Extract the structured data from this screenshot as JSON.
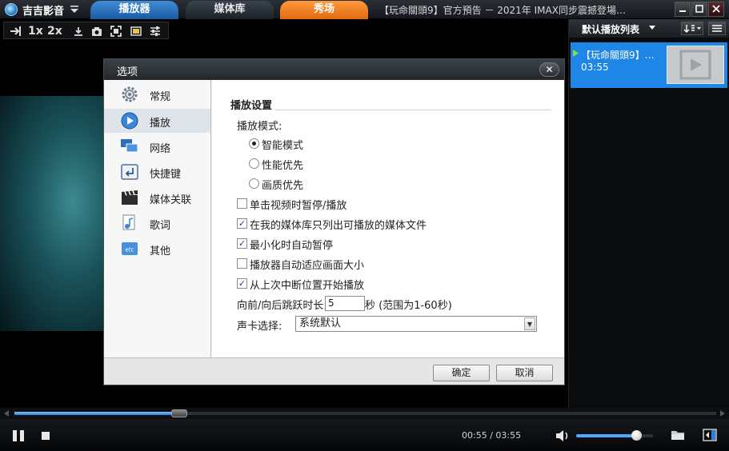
{
  "app": {
    "name": "吉吉影音",
    "tabs": [
      {
        "label": "播放器"
      },
      {
        "label": "媒体库"
      },
      {
        "label": "秀场"
      }
    ],
    "video_title": "【玩命關頭9】官方預告 － 2021年 IMAX同步震撼登場…"
  },
  "toolbar": {
    "speed_1x": "1x",
    "speed_2x": "2x"
  },
  "playlist": {
    "title": "默认播放列表",
    "items": [
      {
        "title": "【玩命關頭9】…",
        "duration": "03:55"
      }
    ]
  },
  "player": {
    "current_time": "00:55",
    "separator": "/",
    "total_time": "03:55",
    "progress_fraction": 0.235,
    "volume_fraction": 0.79
  },
  "dialog": {
    "title": "选项",
    "close_label": "✕",
    "sidebar": [
      {
        "label": "常规",
        "icon": "gear-icon"
      },
      {
        "label": "播放",
        "icon": "play-icon"
      },
      {
        "label": "网络",
        "icon": "network-icon"
      },
      {
        "label": "快捷键",
        "icon": "shortcut-icon"
      },
      {
        "label": "媒体关联",
        "icon": "clapper-icon"
      },
      {
        "label": "歌词",
        "icon": "lyrics-icon"
      },
      {
        "label": "其他",
        "icon": "etc-icon"
      }
    ],
    "active_index": 1,
    "section_title": "播放设置",
    "play_mode_label": "播放模式:",
    "radios": [
      {
        "label": "智能模式",
        "selected": true
      },
      {
        "label": "性能优先",
        "selected": false
      },
      {
        "label": "画质优先",
        "selected": false
      }
    ],
    "checkboxes": [
      {
        "label": "单击视频时暂停/播放",
        "checked": false
      },
      {
        "label": "在我的媒体库只列出可播放的媒体文件",
        "checked": true
      },
      {
        "label": "最小化时自动暂停",
        "checked": true
      },
      {
        "label": "播放器自动适应画面大小",
        "checked": false
      },
      {
        "label": "从上次中断位置开始播放",
        "checked": true
      }
    ],
    "jump_label": "向前/向后跳跃时长:",
    "jump_value": "5",
    "jump_unit": "秒 (范围为1-60秒)",
    "sound_card_label": "声卡选择:",
    "sound_card_value": "系统默认",
    "ok_label": "确定",
    "cancel_label": "取消"
  },
  "colors": {
    "accent": "#1e86e6",
    "tab_show": "#f07a1a",
    "dialog_bg": "#f2f2f2"
  }
}
